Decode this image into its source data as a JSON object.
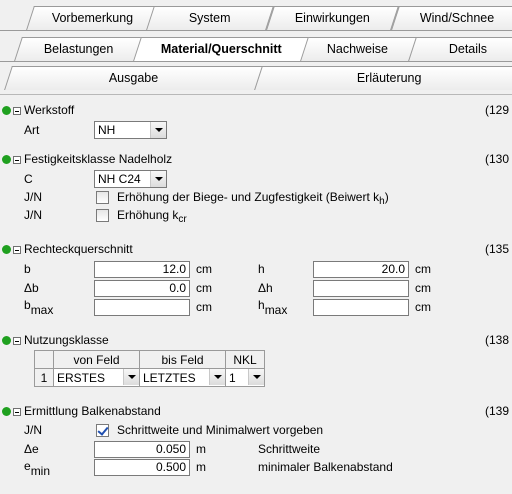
{
  "tabs": {
    "row1": [
      "Vorbemerkung",
      "System",
      "Einwirkungen",
      "Wind/Schnee"
    ],
    "row2": [
      "Belastungen",
      "Material/Querschnitt",
      "Nachweise",
      "Details"
    ],
    "row3": [
      "Ausgabe",
      "Erläuterung"
    ],
    "active": "Material/Querschnitt"
  },
  "werkstoff": {
    "title": "Werkstoff",
    "ref": "(129",
    "art_label": "Art",
    "art_value": "NH"
  },
  "festigkeit": {
    "title": "Festigkeitsklasse Nadelholz",
    "ref": "(130",
    "c_label": "C",
    "c_value": "NH C24",
    "jn_label": "J/N",
    "opt1_text": "Erhöhung der Biege- und Zugfestigkeit (Beiwert k",
    "opt1_sub": "h",
    "opt1_tail": ")",
    "opt1_checked": false,
    "opt2_text": "Erhöhung k",
    "opt2_sub": "cr",
    "opt2_checked": false
  },
  "rechteck": {
    "title": "Rechteckquerschnitt",
    "ref": "(135",
    "b_label": "b",
    "b_value": "12.0",
    "b_unit": "cm",
    "h_label": "h",
    "h_value": "20.0",
    "h_unit": "cm",
    "db_label": "Δb",
    "db_value": "0.0",
    "db_unit": "cm",
    "dh_label": "Δh",
    "dh_value": "",
    "dh_unit": "cm",
    "bmax_label": "b",
    "bmax_sub": "max",
    "bmax_value": "",
    "bmax_unit": "cm",
    "hmax_label": "h",
    "hmax_sub": "max",
    "hmax_value": "",
    "hmax_unit": "cm"
  },
  "nutzung": {
    "title": "Nutzungsklasse",
    "ref": "(138",
    "headers": [
      "von Feld",
      "bis Feld",
      "NKL"
    ],
    "row_index": "1",
    "von_feld": "ERSTES",
    "bis_feld": "LETZTES",
    "nkl": "1"
  },
  "balken": {
    "title": "Ermittlung Balkenabstand",
    "ref": "(139",
    "jn_label": "J/N",
    "chk_text": "Schrittweite und Minimalwert vorgeben",
    "chk_checked": true,
    "de_label": "Δe",
    "de_value": "0.050",
    "de_unit": "m",
    "de_desc": "Schrittweite",
    "emin_label": "e",
    "emin_sub": "min",
    "emin_value": "0.500",
    "emin_unit": "m",
    "emin_desc": "minimaler Balkenabstand"
  },
  "colors": {
    "status_dot": "#1fa01f",
    "check": "#1f4fb0"
  }
}
